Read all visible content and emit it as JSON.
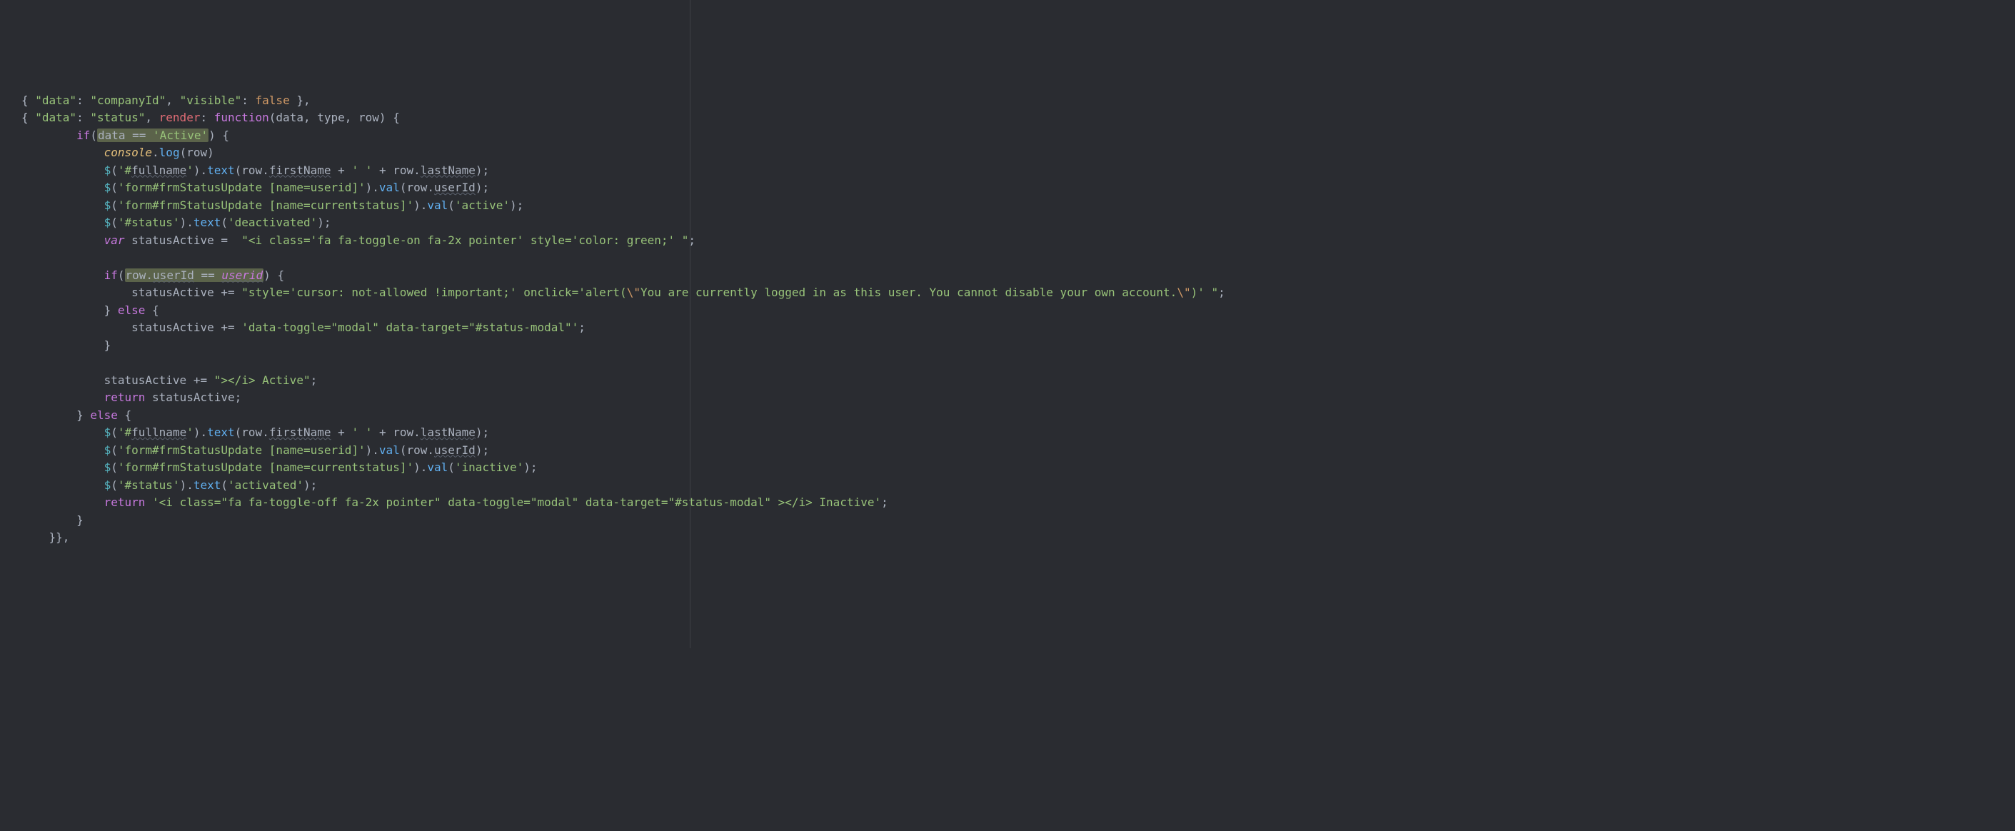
{
  "lines": [
    {
      "segs": [
        [
          "p",
          "{ "
        ],
        [
          "s",
          "\"data\""
        ],
        [
          "p",
          ": "
        ],
        [
          "s",
          "\"companyId\""
        ],
        [
          "p",
          ", "
        ],
        [
          "s",
          "\"visible\""
        ],
        [
          "p",
          ": "
        ],
        [
          "o",
          "false"
        ],
        [
          "p",
          " },"
        ]
      ]
    },
    {
      "segs": [
        [
          "p",
          "{ "
        ],
        [
          "s",
          "\"data\""
        ],
        [
          "p",
          ": "
        ],
        [
          "s",
          "\"status\""
        ],
        [
          "p",
          ", "
        ],
        [
          "pr",
          "render"
        ],
        [
          "p",
          ": "
        ],
        [
          "k",
          "function"
        ],
        [
          "p",
          "("
        ],
        [
          "n",
          "data"
        ],
        [
          "p",
          ", "
        ],
        [
          "n",
          "type"
        ],
        [
          "p",
          ", "
        ],
        [
          "n",
          "row"
        ],
        [
          "p",
          ") {"
        ]
      ]
    },
    {
      "segs": [
        [
          "p",
          "        "
        ],
        [
          "k",
          "if"
        ],
        [
          "p",
          "("
        ],
        [
          "hl",
          [
            [
              "n",
              "data "
            ],
            [
              "p",
              "== "
            ],
            [
              "s",
              "'Active'"
            ]
          ]
        ],
        [
          "p",
          ") {"
        ]
      ]
    },
    {
      "segs": [
        [
          "p",
          "            "
        ],
        [
          "ob",
          "console"
        ],
        [
          "p",
          "."
        ],
        [
          "fn",
          "log"
        ],
        [
          "p",
          "("
        ],
        [
          "n",
          "row"
        ],
        [
          "p",
          ")"
        ]
      ]
    },
    {
      "segs": [
        [
          "p",
          "            "
        ],
        [
          "dl",
          "$"
        ],
        [
          "p",
          "("
        ],
        [
          "s",
          "'#"
        ],
        [
          "id",
          "fullname"
        ],
        [
          "s",
          "'"
        ],
        [
          "p",
          ")."
        ],
        [
          "fn",
          "text"
        ],
        [
          "p",
          "("
        ],
        [
          "n",
          "row"
        ],
        [
          "p",
          "."
        ],
        [
          "id",
          "firstName"
        ],
        [
          "p",
          " + "
        ],
        [
          "s",
          "' '"
        ],
        [
          "p",
          " + "
        ],
        [
          "n",
          "row"
        ],
        [
          "p",
          "."
        ],
        [
          "id",
          "lastName"
        ],
        [
          "p",
          ");"
        ]
      ]
    },
    {
      "segs": [
        [
          "p",
          "            "
        ],
        [
          "dl",
          "$"
        ],
        [
          "p",
          "("
        ],
        [
          "s",
          "'form#frmStatusUpdate [name=userid]'"
        ],
        [
          "p",
          ")."
        ],
        [
          "fn",
          "val"
        ],
        [
          "p",
          "("
        ],
        [
          "n",
          "row"
        ],
        [
          "p",
          "."
        ],
        [
          "id",
          "userId"
        ],
        [
          "p",
          ");"
        ]
      ]
    },
    {
      "segs": [
        [
          "p",
          "            "
        ],
        [
          "dl",
          "$"
        ],
        [
          "p",
          "("
        ],
        [
          "s",
          "'form#frmStatusUpdate [name=currentstatus]'"
        ],
        [
          "p",
          ")."
        ],
        [
          "fn",
          "val"
        ],
        [
          "p",
          "("
        ],
        [
          "s",
          "'active'"
        ],
        [
          "p",
          ");"
        ]
      ]
    },
    {
      "segs": [
        [
          "p",
          "            "
        ],
        [
          "dl",
          "$"
        ],
        [
          "p",
          "("
        ],
        [
          "s",
          "'#status'"
        ],
        [
          "p",
          ")."
        ],
        [
          "fn",
          "text"
        ],
        [
          "p",
          "("
        ],
        [
          "s",
          "'deactivated'"
        ],
        [
          "p",
          ");"
        ]
      ]
    },
    {
      "segs": [
        [
          "p",
          "            "
        ],
        [
          "kw",
          "var"
        ],
        [
          "p",
          " "
        ],
        [
          "n",
          "statusActive"
        ],
        [
          "p",
          " =  "
        ],
        [
          "s",
          "\"<i class='fa fa-toggle-on fa-2x pointer' style='color: green;' \""
        ],
        [
          "p",
          ";"
        ]
      ]
    },
    {
      "segs": [
        [
          "p",
          " "
        ]
      ]
    },
    {
      "segs": [
        [
          "p",
          "            "
        ],
        [
          "k",
          "if"
        ],
        [
          "p",
          "("
        ],
        [
          "hl",
          [
            [
              "n",
              "row"
            ],
            [
              "p",
              "."
            ],
            [
              "id",
              "userId"
            ],
            [
              "p",
              " == "
            ],
            [
              "idv",
              "userid"
            ]
          ]
        ],
        [
          "p",
          ") {"
        ]
      ]
    },
    {
      "segs": [
        [
          "p",
          "                "
        ],
        [
          "n",
          "statusActive"
        ],
        [
          "p",
          " += "
        ],
        [
          "s",
          "\"style='cursor: not-allowed !important;' onclick='alert("
        ],
        [
          "o",
          "\\\""
        ],
        [
          "s",
          "You are currently logged in as this user. You cannot disable your own account."
        ],
        [
          "o",
          "\\\""
        ],
        [
          "s",
          ")' \""
        ],
        [
          "p",
          ";"
        ]
      ]
    },
    {
      "segs": [
        [
          "p",
          "            } "
        ],
        [
          "k",
          "else"
        ],
        [
          "p",
          " {"
        ]
      ]
    },
    {
      "segs": [
        [
          "p",
          "                "
        ],
        [
          "n",
          "statusActive"
        ],
        [
          "p",
          " += "
        ],
        [
          "s",
          "'data-toggle=\"modal\" data-target=\"#status-modal\"'"
        ],
        [
          "p",
          ";"
        ]
      ]
    },
    {
      "segs": [
        [
          "p",
          "            }"
        ]
      ]
    },
    {
      "segs": [
        [
          "p",
          " "
        ]
      ]
    },
    {
      "segs": [
        [
          "p",
          "            "
        ],
        [
          "n",
          "statusActive"
        ],
        [
          "p",
          " += "
        ],
        [
          "s",
          "\"></i> Active\""
        ],
        [
          "p",
          ";"
        ]
      ]
    },
    {
      "segs": [
        [
          "p",
          "            "
        ],
        [
          "k",
          "return"
        ],
        [
          "p",
          " "
        ],
        [
          "n",
          "statusActive"
        ],
        [
          "p",
          ";"
        ]
      ]
    },
    {
      "segs": [
        [
          "p",
          "        } "
        ],
        [
          "k",
          "else"
        ],
        [
          "p",
          " {"
        ]
      ]
    },
    {
      "segs": [
        [
          "p",
          "            "
        ],
        [
          "dl",
          "$"
        ],
        [
          "p",
          "("
        ],
        [
          "s",
          "'#"
        ],
        [
          "id",
          "fullname"
        ],
        [
          "s",
          "'"
        ],
        [
          "p",
          ")."
        ],
        [
          "fn",
          "text"
        ],
        [
          "p",
          "("
        ],
        [
          "n",
          "row"
        ],
        [
          "p",
          "."
        ],
        [
          "id",
          "firstName"
        ],
        [
          "p",
          " + "
        ],
        [
          "s",
          "' '"
        ],
        [
          "p",
          " + "
        ],
        [
          "n",
          "row"
        ],
        [
          "p",
          "."
        ],
        [
          "id",
          "lastName"
        ],
        [
          "p",
          ");"
        ]
      ]
    },
    {
      "segs": [
        [
          "p",
          "            "
        ],
        [
          "dl",
          "$"
        ],
        [
          "p",
          "("
        ],
        [
          "s",
          "'form#frmStatusUpdate [name=userid]'"
        ],
        [
          "p",
          ")."
        ],
        [
          "fn",
          "val"
        ],
        [
          "p",
          "("
        ],
        [
          "n",
          "row"
        ],
        [
          "p",
          "."
        ],
        [
          "id",
          "userId"
        ],
        [
          "p",
          ");"
        ]
      ]
    },
    {
      "segs": [
        [
          "p",
          "            "
        ],
        [
          "dl",
          "$"
        ],
        [
          "p",
          "("
        ],
        [
          "s",
          "'form#frmStatusUpdate [name=currentstatus]'"
        ],
        [
          "p",
          ")."
        ],
        [
          "fn",
          "val"
        ],
        [
          "p",
          "("
        ],
        [
          "s",
          "'inactive'"
        ],
        [
          "p",
          ");"
        ]
      ]
    },
    {
      "segs": [
        [
          "p",
          "            "
        ],
        [
          "dl",
          "$"
        ],
        [
          "p",
          "("
        ],
        [
          "s",
          "'#status'"
        ],
        [
          "p",
          ")."
        ],
        [
          "fn",
          "text"
        ],
        [
          "p",
          "("
        ],
        [
          "s",
          "'activated'"
        ],
        [
          "p",
          ");"
        ]
      ]
    },
    {
      "segs": [
        [
          "p",
          "            "
        ],
        [
          "k",
          "return"
        ],
        [
          "p",
          " "
        ],
        [
          "s",
          "'<i class=\"fa fa-toggle-off fa-2x pointer\" data-toggle=\"modal\" data-target=\"#status-modal\" ></i> Inactive'"
        ],
        [
          "p",
          ";"
        ]
      ]
    },
    {
      "segs": [
        [
          "p",
          "        }"
        ]
      ]
    },
    {
      "segs": [
        [
          "p",
          "    }},"
        ]
      ]
    }
  ]
}
